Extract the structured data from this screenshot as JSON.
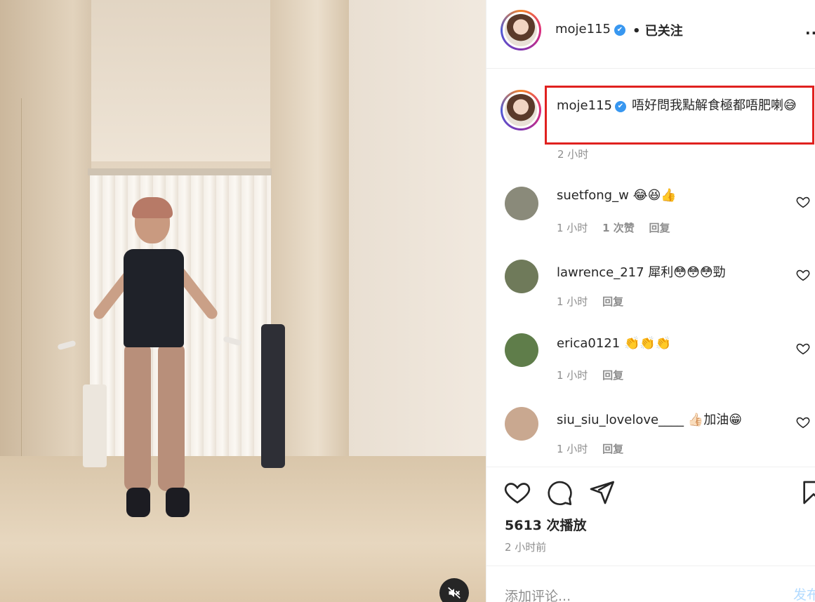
{
  "post": {
    "username": "moje115",
    "follow_status": "已关注",
    "more_label": "..."
  },
  "caption": {
    "username": "moje115",
    "text": "唔好問我點解食極都唔肥喇",
    "emoji": "😅",
    "time": "2 小时"
  },
  "comments": [
    {
      "username": "suetfong_w",
      "text": "😂😆👍",
      "time": "1 小时",
      "likes": "1 次赞",
      "reply": "回复",
      "avatar_color": "#8a8a7a"
    },
    {
      "username": "lawrence_217",
      "text": "犀利😳😳😳勁",
      "time": "1 小时",
      "likes": "",
      "reply": "回复",
      "avatar_color": "#6f7a5a"
    },
    {
      "username": "erica0121",
      "text": "👏👏👏",
      "time": "1 小时",
      "likes": "",
      "reply": "回复",
      "avatar_color": "#5f7d4a"
    },
    {
      "username": "siu_siu_lovelove____",
      "text": "👍🏻加油😁",
      "time": "1 小时",
      "likes": "",
      "reply": "回复",
      "avatar_color": "#c9a890"
    }
  ],
  "stats": {
    "views": "5613 次播放",
    "posted": "2 小时前"
  },
  "composer": {
    "placeholder": "添加评论...",
    "post_label": "发布"
  },
  "icons": {
    "like": "heart-icon",
    "comment": "comment-icon",
    "share": "share-icon",
    "save": "bookmark-icon",
    "mute": "muted-speaker-icon",
    "verified": "verified-badge-icon"
  },
  "colors": {
    "highlight_box": "#e0211f",
    "verified": "#3897f0",
    "muted_text": "#8e8e8e"
  }
}
